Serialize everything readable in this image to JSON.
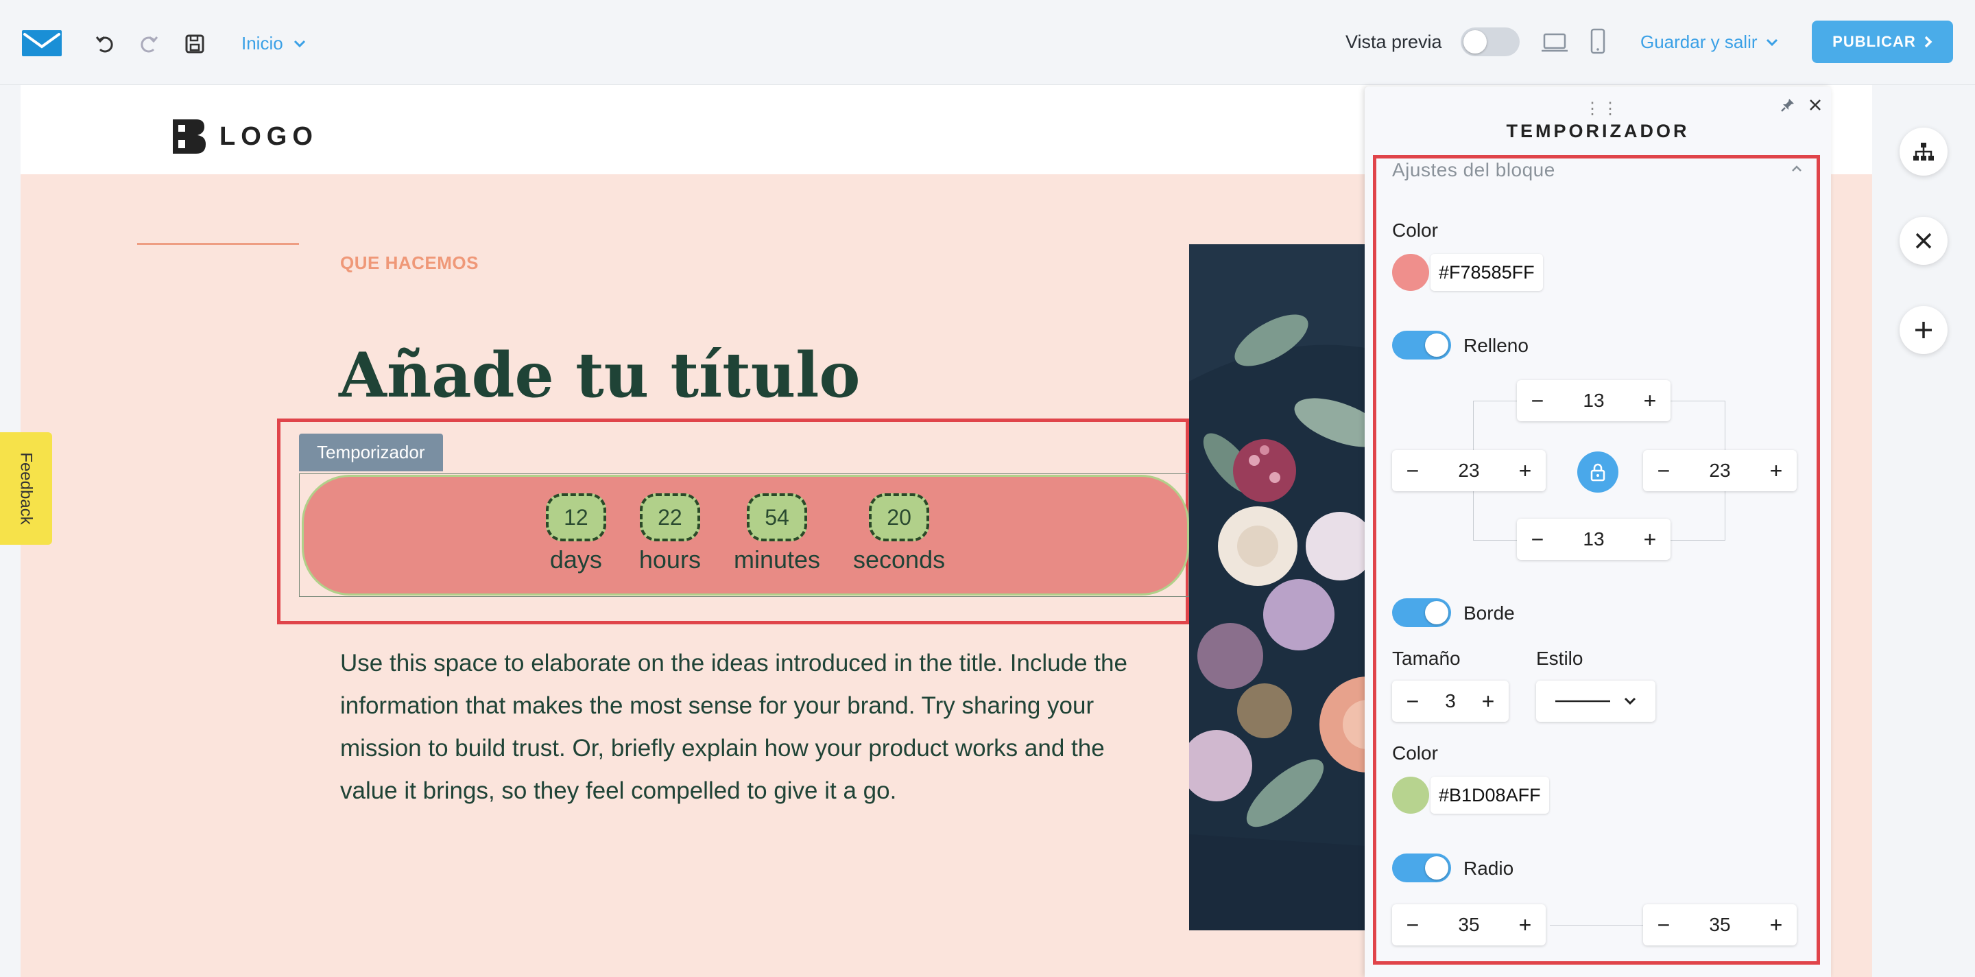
{
  "toolbar": {
    "page_select": "Inicio",
    "preview_label": "Vista previa",
    "save_exit": "Guardar y salir",
    "publish": "PUBLICAR"
  },
  "site": {
    "logo_text": "LOGO",
    "eyebrow": "QUE HACEMOS",
    "title": "Añade tu título",
    "body": "Use this space to elaborate on the ideas introduced in the title. Include the information that makes the most sense for your brand. Try sharing your mission to build trust. Or, briefly explain how your product works and the value it brings, so they feel compelled to give it a go."
  },
  "timer": {
    "tag": "Temporizador",
    "units": [
      {
        "value": "12",
        "label": "days"
      },
      {
        "value": "22",
        "label": "hours"
      },
      {
        "value": "54",
        "label": "minutes"
      },
      {
        "value": "20",
        "label": "seconds"
      }
    ]
  },
  "panel": {
    "title": "TEMPORIZADOR",
    "section": "Ajustes del bloque",
    "color_label": "Color",
    "color_hex": "#F78585FF",
    "fill_label": "Relleno",
    "padding": {
      "top": "13",
      "left": "23",
      "right": "23",
      "bottom": "13"
    },
    "border_label": "Borde",
    "size_label": "Tamaño",
    "style_label": "Estilo",
    "border_size": "3",
    "border_color_label": "Color",
    "border_color_hex": "#B1D08AFF",
    "radius_label": "Radio",
    "radius": {
      "left": "35",
      "right": "35"
    }
  },
  "feedback": "Feedback",
  "colors": {
    "accent": "#4aa8ea",
    "timer_bg": "#F78585",
    "timer_border": "#B1D08A",
    "selection": "#e0444a"
  }
}
